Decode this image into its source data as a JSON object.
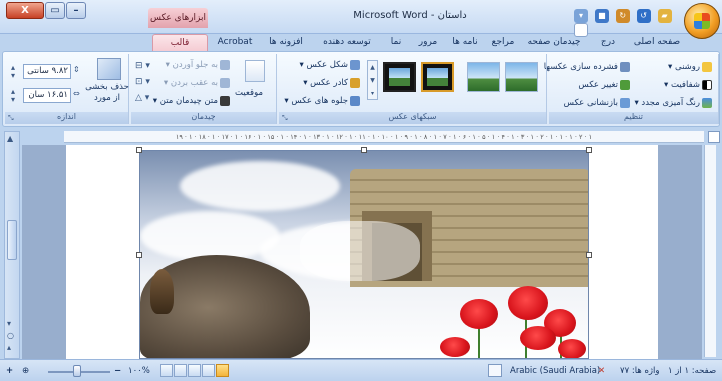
{
  "window": {
    "title": "Microsoft Word - داستان",
    "context_tab_title": "ابزارهای عکس",
    "buttons": {
      "close": "X"
    }
  },
  "tabs": [
    {
      "label": "صفحه اصلی"
    },
    {
      "label": "درج"
    },
    {
      "label": "چیدمان صفحه"
    },
    {
      "label": "مراجع"
    },
    {
      "label": "نامه ها"
    },
    {
      "label": "مرور"
    },
    {
      "label": "نما"
    },
    {
      "label": "توسعه دهنده"
    },
    {
      "label": "افزونه ها"
    },
    {
      "label": "Acrobat"
    },
    {
      "label": "قالب",
      "active": true
    }
  ],
  "ribbon": {
    "adjust": {
      "label": "تنظیم",
      "items": [
        "روشنی",
        "شفافیت",
        "رنگ آمیزی مجدد",
        "فشرده سازی عکسها",
        "تغییر عکس",
        "بازنشانی عکس"
      ]
    },
    "picture_styles": {
      "label": "سبکهای عکس",
      "items": [
        "شکل عکس",
        "کادر عکس",
        "جلوه های عکس"
      ]
    },
    "arrange": {
      "label": "چیدمان",
      "items": [
        "به جلو آوردن",
        "به عقب بردن",
        "موقعیت",
        "متن چیدمان متن"
      ]
    },
    "size": {
      "label": "اندازه",
      "crop_label": "حذف بخشی از مورد",
      "height_value": "۹.۸۲ سانتی",
      "width_value": "۱۶.۵۱ سان"
    }
  },
  "rulers": {
    "horizontal_ticks": "۱۹ · ۱ · ۱۸ · ۱ · ۱۷ · ۱ · ۱۶ · ۱ · ۱۵ · ۱ · ۱۴ · ۱ · ۱۳ · ۱ · ۱۲ · ۱ · ۱۱ · ۱ · ۱۰ · ۱ · ۹ · ۱ · ۸ · ۱ · ۷ · ۱ · ۶ · ۱ · ۵ · ۱ · ۴ · ۱ · ۳ · ۱ · ۲ · ۱ · ۱ · ۱ · ۲ · ۱"
  },
  "statusbar": {
    "page": "صفحه: ۱ از ۱",
    "words": "واژه ها: ۷۷",
    "language": "Arabic (Saudi Arabia)",
    "zoom": "۱۰۰%",
    "zoom_minus": "−",
    "zoom_plus": "+"
  },
  "colors": {
    "ribbon_bg": "#dbe8f8",
    "context_tab": "#e3a2ad",
    "close_button": "#c74125"
  },
  "icons": [
    "help-icon",
    "office-button-icon",
    "save-icon",
    "undo-icon",
    "redo-icon",
    "open-icon",
    "new-icon"
  ]
}
